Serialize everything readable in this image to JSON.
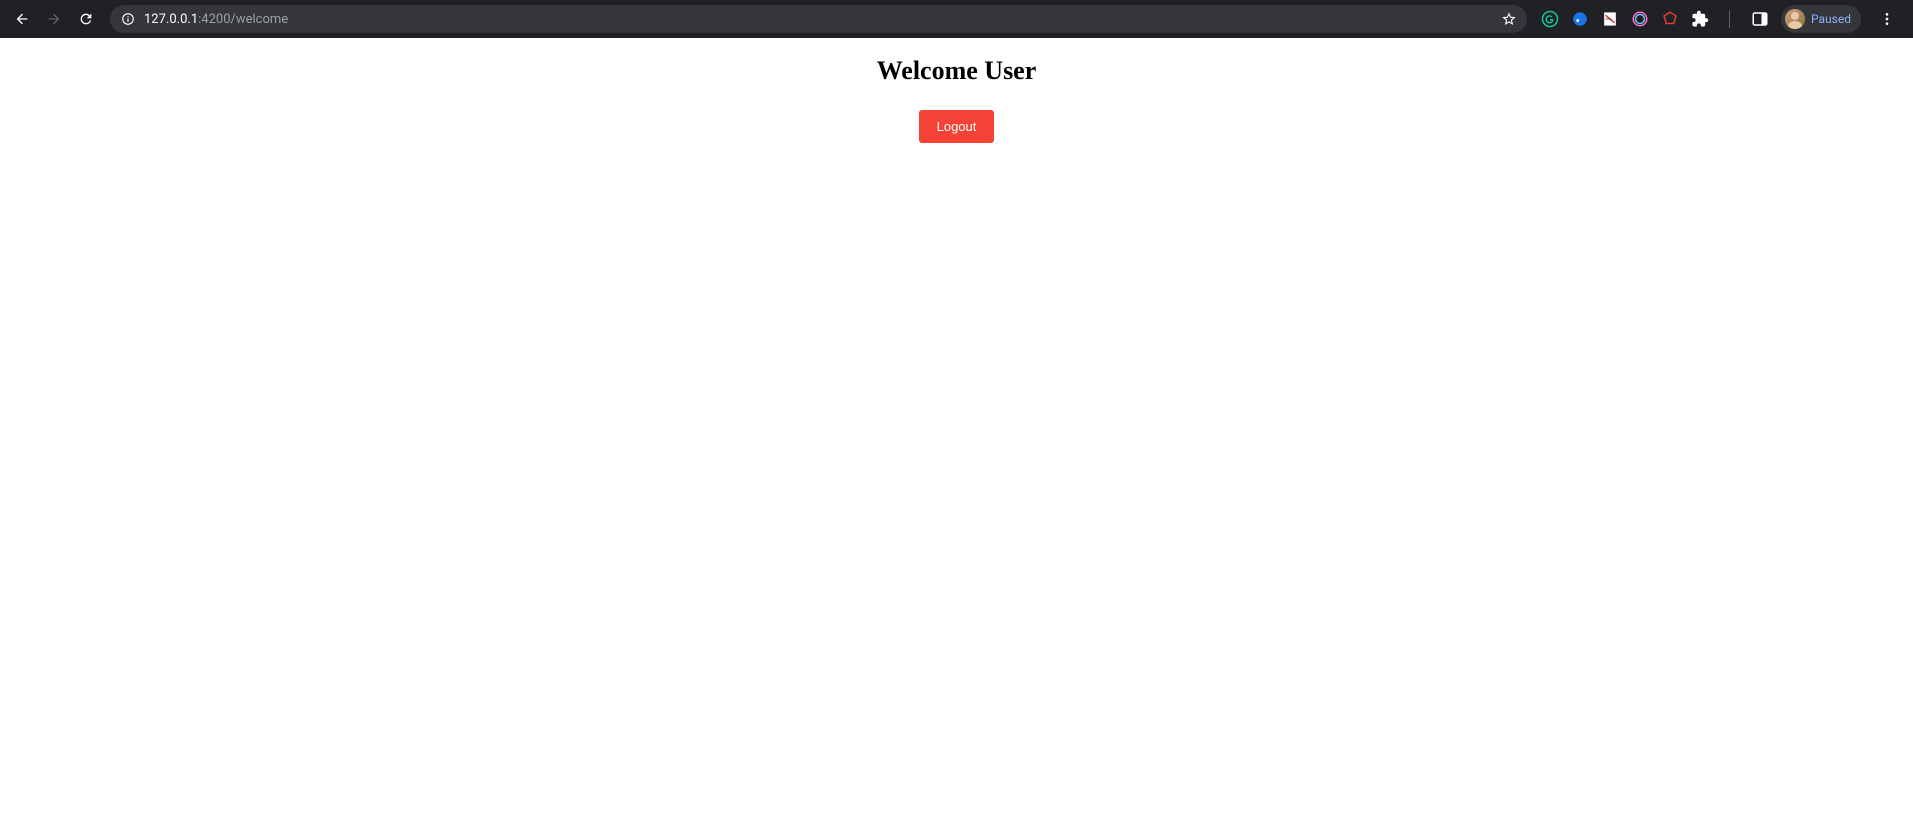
{
  "browser": {
    "url_host": "127.0.0.1",
    "url_port_path": ":4200/welcome",
    "profile_status": "Paused"
  },
  "page": {
    "heading": "Welcome User",
    "logout_label": "Logout"
  }
}
